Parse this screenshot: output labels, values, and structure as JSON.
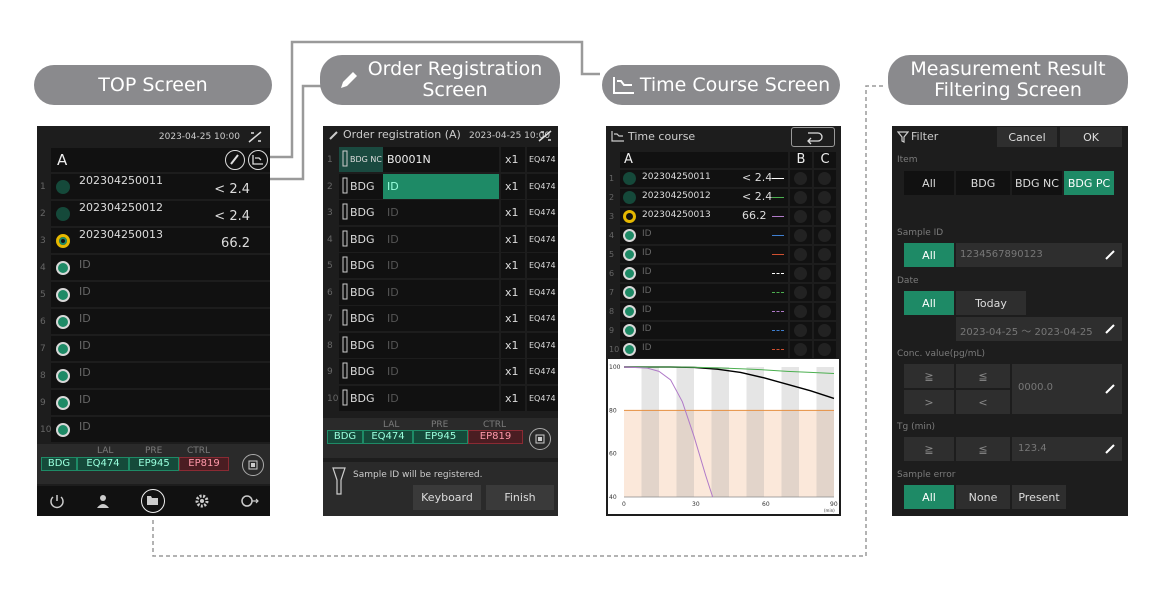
{
  "labels": {
    "top": "TOP Screen",
    "order_l1": "Order Registration",
    "order_l2": "Screen",
    "time": "Time Course Screen",
    "filter_l1": "Measurement Result",
    "filter_l2": "Filtering Screen"
  },
  "top": {
    "datetime": "2023-04-25 10:00",
    "group": "A",
    "rows": [
      {
        "num": "1",
        "id": "202304250011",
        "val": "< 2.4",
        "state": "done"
      },
      {
        "num": "2",
        "id": "202304250012",
        "val": "< 2.4",
        "state": "done"
      },
      {
        "num": "3",
        "id": "202304250013",
        "val": "66.2",
        "state": "active"
      },
      {
        "num": "4",
        "id": "ID",
        "val": "",
        "state": "empty"
      },
      {
        "num": "5",
        "id": "ID",
        "val": "",
        "state": "empty"
      },
      {
        "num": "6",
        "id": "ID",
        "val": "",
        "state": "empty"
      },
      {
        "num": "7",
        "id": "ID",
        "val": "",
        "state": "empty"
      },
      {
        "num": "8",
        "id": "ID",
        "val": "",
        "state": "empty"
      },
      {
        "num": "9",
        "id": "ID",
        "val": "",
        "state": "empty"
      },
      {
        "num": "10",
        "id": "ID",
        "val": "",
        "state": "empty"
      }
    ],
    "reagent_heads": [
      "LAL",
      "PRE",
      "CTRL"
    ],
    "reagents": [
      "BDG",
      "EQ474",
      "EP945",
      "EP819"
    ]
  },
  "order": {
    "title": "Order registration (A)",
    "datetime": "2023-04-25 10:00",
    "rows": [
      {
        "num": "1",
        "type": "BDG NC",
        "id": "B0001N",
        "x": "x1",
        "lot": "EQ474"
      },
      {
        "num": "2",
        "type": "BDG",
        "id": "ID",
        "x": "x1",
        "lot": "EQ474"
      },
      {
        "num": "3",
        "type": "BDG",
        "id": "ID",
        "x": "x1",
        "lot": "EQ474"
      },
      {
        "num": "4",
        "type": "BDG",
        "id": "ID",
        "x": "x1",
        "lot": "EQ474"
      },
      {
        "num": "5",
        "type": "BDG",
        "id": "ID",
        "x": "x1",
        "lot": "EQ474"
      },
      {
        "num": "6",
        "type": "BDG",
        "id": "ID",
        "x": "x1",
        "lot": "EQ474"
      },
      {
        "num": "7",
        "type": "BDG",
        "id": "ID",
        "x": "x1",
        "lot": "EQ474"
      },
      {
        "num": "8",
        "type": "BDG",
        "id": "ID",
        "x": "x1",
        "lot": "EQ474"
      },
      {
        "num": "9",
        "type": "BDG",
        "id": "ID",
        "x": "x1",
        "lot": "EQ474"
      },
      {
        "num": "10",
        "type": "BDG",
        "id": "ID",
        "x": "x1",
        "lot": "EQ474"
      }
    ],
    "reagent_heads": [
      "LAL",
      "PRE",
      "CTRL"
    ],
    "reagents": [
      "BDG",
      "EQ474",
      "EP945",
      "EP819"
    ],
    "message": "Sample ID will be registered.",
    "keyboard": "Keyboard",
    "finish": "Finish"
  },
  "time": {
    "title": "Time course",
    "group": "A",
    "col_b": "B",
    "col_c": "C",
    "rows": [
      {
        "num": "1",
        "id": "202304250011",
        "val": "< 2.4",
        "state": "done",
        "line": "#ffffff",
        "dash": false
      },
      {
        "num": "2",
        "id": "202304250012",
        "val": "< 2.4",
        "state": "done",
        "line": "#4caf50",
        "dash": false
      },
      {
        "num": "3",
        "id": "202304250013",
        "val": "66.2",
        "state": "active",
        "line": "#b07ac8",
        "dash": false
      },
      {
        "num": "4",
        "id": "ID",
        "val": "",
        "state": "empty",
        "line": "#3f7fd0",
        "dash": false
      },
      {
        "num": "5",
        "id": "ID",
        "val": "",
        "state": "empty",
        "line": "#d05030",
        "dash": false
      },
      {
        "num": "6",
        "id": "ID",
        "val": "",
        "state": "empty",
        "line": "#ffffff",
        "dash": true
      },
      {
        "num": "7",
        "id": "ID",
        "val": "",
        "state": "empty",
        "line": "#4caf50",
        "dash": true
      },
      {
        "num": "8",
        "id": "ID",
        "val": "",
        "state": "empty",
        "line": "#b07ac8",
        "dash": true
      },
      {
        "num": "9",
        "id": "ID",
        "val": "",
        "state": "empty",
        "line": "#3f7fd0",
        "dash": true
      },
      {
        "num": "10",
        "id": "ID",
        "val": "",
        "state": "empty",
        "line": "#d05030",
        "dash": true
      }
    ]
  },
  "chart_data": {
    "type": "line",
    "xlabel": "(min)",
    "ylabel": "",
    "xlim": [
      0,
      90
    ],
    "ylim": [
      40,
      100
    ],
    "xticks": [
      "0",
      "30",
      "60",
      "90"
    ],
    "yticks": [
      "100",
      "80",
      "60",
      "40"
    ],
    "threshold": 80,
    "series": [
      {
        "color": "#000000",
        "x": [
          0,
          20,
          30,
          40,
          50,
          60,
          70,
          80,
          90
        ],
        "y": [
          100,
          100,
          99.8,
          99,
          97.5,
          95,
          92,
          89,
          85.5
        ]
      },
      {
        "color": "#4caf50",
        "x": [
          0,
          20,
          30,
          40,
          50,
          60,
          70,
          80,
          90
        ],
        "y": [
          100,
          100,
          99.9,
          99.6,
          99.2,
          98.7,
          98,
          97.5,
          97
        ]
      },
      {
        "color": "#b07ac8",
        "x": [
          0,
          10,
          15,
          20,
          25,
          30,
          35,
          38
        ],
        "y": [
          100,
          99.5,
          98,
          94,
          84,
          68,
          50,
          40
        ]
      }
    ]
  },
  "filter": {
    "title": "Filter",
    "cancel": "Cancel",
    "ok": "OK",
    "item_label": "Item",
    "items": [
      "All",
      "BDG",
      "BDG NC",
      "BDG PC"
    ],
    "sample_id_label": "Sample ID",
    "sample_all": "All",
    "sample_value": "1234567890123",
    "date_label": "Date",
    "date_all": "All",
    "date_today": "Today",
    "date_range": "2023-04-25 ～ 2023-04-25",
    "conc_label": "Conc. value(pg/mL)",
    "conc_ops": [
      "≧",
      "≦",
      ">",
      "<"
    ],
    "conc_value": "0000.0",
    "tg_label": "Tg (min)",
    "tg_ops": [
      "≧",
      "≦"
    ],
    "tg_value": "123.4",
    "err_label": "Sample error",
    "err_opts": [
      "All",
      "None",
      "Present"
    ]
  }
}
